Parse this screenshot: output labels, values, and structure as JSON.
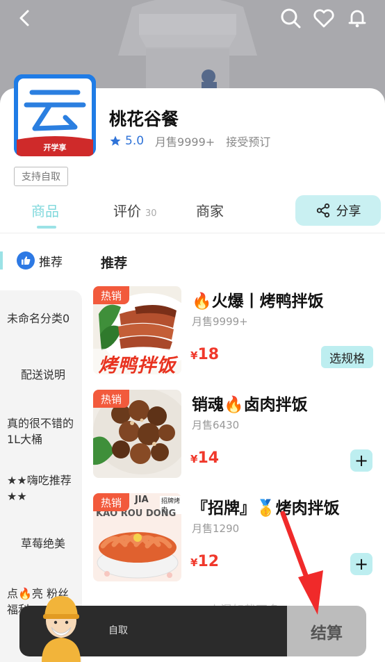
{
  "header": {
    "back_icon": "back-arrow-icon",
    "search_icon": "search-icon",
    "favorite_icon": "heart-icon",
    "notification_icon": "bell-icon"
  },
  "shop": {
    "logo_text": "开学享",
    "name": "桃花谷餐",
    "rating": "5.0",
    "monthly_sales": "月售9999+",
    "reservation": "接受预订",
    "pickup_tag": "支持自取"
  },
  "tabs": {
    "goods": "商品",
    "reviews": "评价",
    "reviews_count": "30",
    "merchant": "商家",
    "share": "分享"
  },
  "sidebar": {
    "recommend": "推荐",
    "items": [
      "未命名分类0",
      "配送说明",
      "真的很不错的1L大桶",
      "★★嗨吃推荐★★",
      "草莓绝美",
      "点🔥亮 粉丝福利"
    ]
  },
  "category_title": "推荐",
  "products": [
    {
      "badge": "热销",
      "name": "🔥火爆丨烤鸭拌饭",
      "sold": "月售9999+",
      "currency": "¥",
      "price": "18",
      "action": "选规格",
      "image_text": "烤鸭拌饭"
    },
    {
      "badge": "热销",
      "name": "销魂🔥卤肉拌饭",
      "sold": "月售6430",
      "currency": "¥",
      "price": "14",
      "action": "+"
    },
    {
      "badge": "热销",
      "name": "『招牌』🥇烤肉拌饭",
      "sold": "月售1290",
      "currency": "¥",
      "price": "12",
      "action": "+",
      "image_text_top": "JIA",
      "image_text_mid": "KAO ROU DONG",
      "image_tag": "招牌烤肉"
    }
  ],
  "bottom_bar": {
    "pickup": "自取",
    "checkout": "结算",
    "faded_text": "小混如哉不多"
  },
  "colors": {
    "accent": "#9be2e6",
    "price": "#f0382b",
    "hot_badge": "#f25a3c",
    "rating": "#2f73d8",
    "arrow": "#f02a2a"
  }
}
